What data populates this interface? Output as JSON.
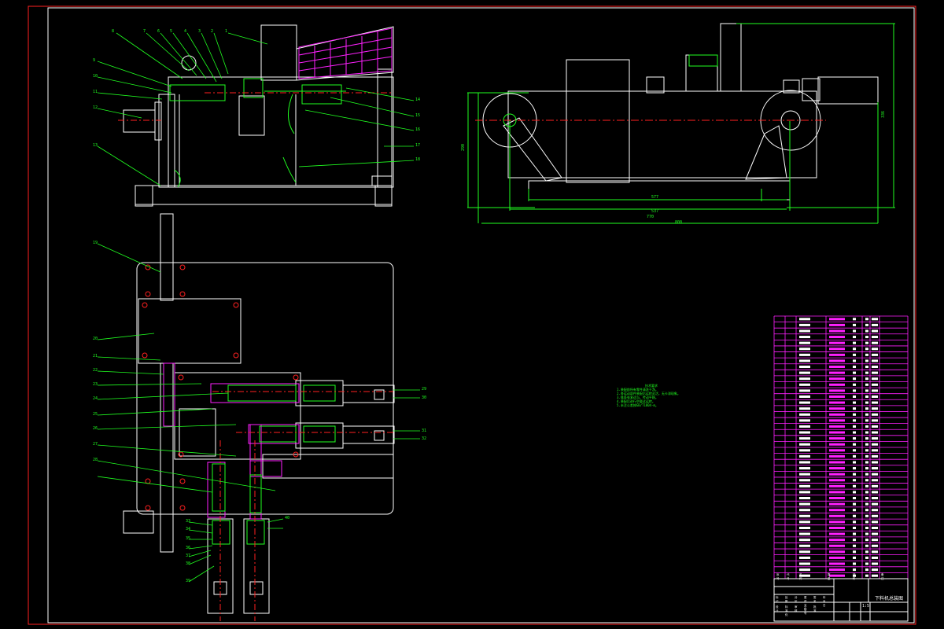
{
  "drawing": {
    "title_block": {
      "drawing_title": "下料机总装图",
      "scale": "1:5",
      "rows": [
        "标记",
        "处数",
        "分区",
        "更改文件号",
        "签名",
        "年月日",
        "设计",
        "标准化",
        "审核",
        "工艺",
        "批准"
      ],
      "cells": [
        "序号",
        "代号",
        "名称",
        "数量",
        "材料",
        "备注"
      ]
    },
    "tech_requirements": {
      "heading": "技术要求",
      "lines": [
        "1.装配前所有零件清洗干净。",
        "2.各运动部件装配后运转灵活，无卡滞现象。",
        "3.链条张紧适当，传动平稳。",
        "4.装配后进行空载试运转。",
        "5.未注公差按GB/T1804-m。"
      ]
    },
    "dimensions": {
      "side_height": "336",
      "side_overall": "800",
      "side_mid": "770",
      "side_inner": "577",
      "side_base": "537",
      "side_left": "290"
    },
    "balloon_labels": {
      "top_view": [
        "8",
        "7",
        "6",
        "5",
        "4",
        "3",
        "2",
        "1"
      ],
      "top_left": [
        "9",
        "10",
        "11",
        "12",
        "13"
      ],
      "top_right": [
        "14",
        "15",
        "16",
        "17",
        "18"
      ],
      "plan_left": [
        "19",
        "20",
        "21",
        "22",
        "23",
        "24",
        "25",
        "26",
        "27",
        "28"
      ],
      "plan_right": [
        "29",
        "30",
        "31",
        "32"
      ],
      "plan_bottom": [
        "33",
        "34",
        "35",
        "36",
        "37",
        "38",
        "39",
        "40"
      ]
    },
    "bom_count": 44
  }
}
